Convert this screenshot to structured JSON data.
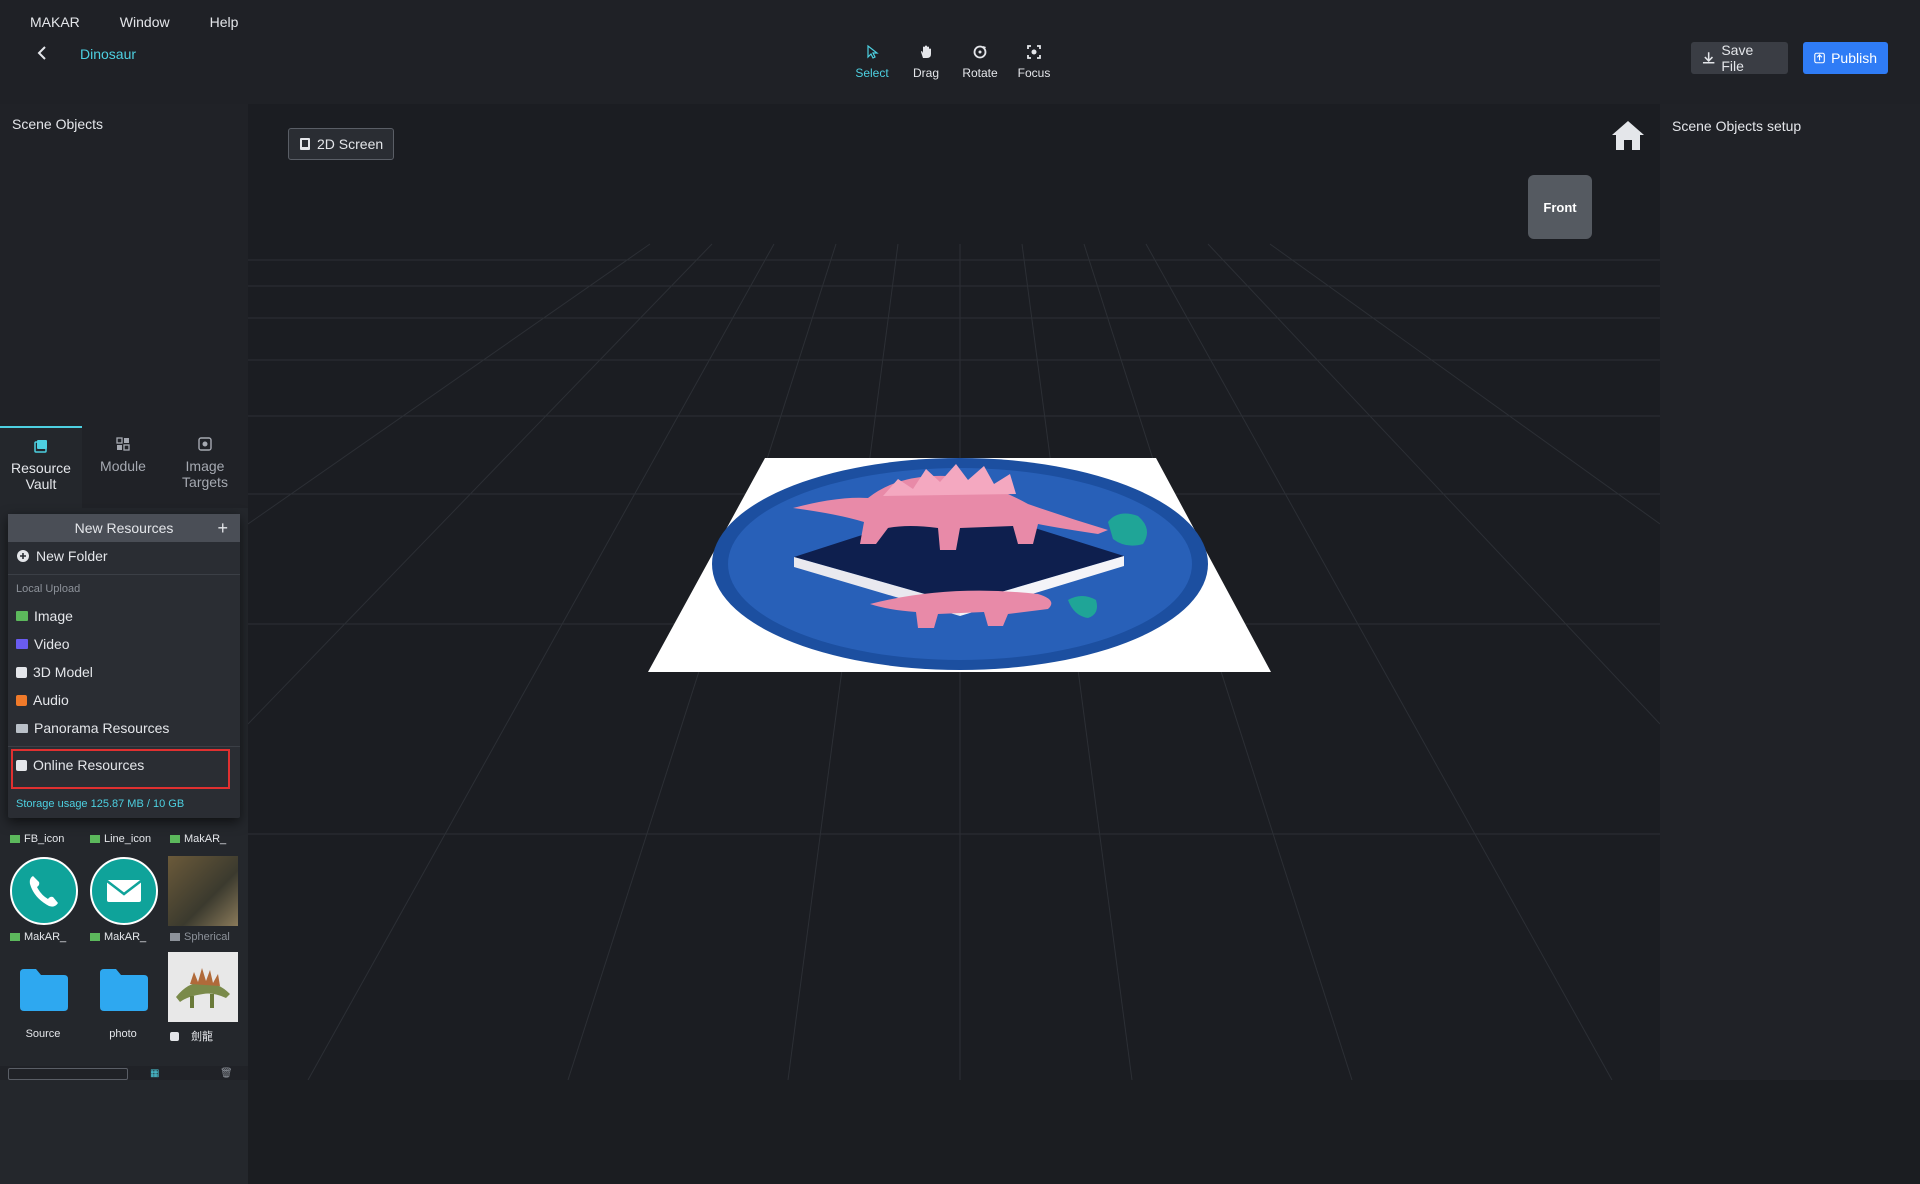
{
  "menu": [
    "MAKAR",
    "Window",
    "Help"
  ],
  "project_name": "Dinosaur",
  "tools": [
    {
      "label": "Select",
      "icon": "cursor-icon",
      "active": true
    },
    {
      "label": "Drag",
      "icon": "hand-icon",
      "active": false
    },
    {
      "label": "Rotate",
      "icon": "rotate-icon",
      "active": false
    },
    {
      "label": "Focus",
      "icon": "focus-icon",
      "active": false
    }
  ],
  "buttons": {
    "save": "Save File",
    "publish": "Publish"
  },
  "left_panel": {
    "title": "Scene Objects",
    "tabs": [
      {
        "label": "Resource Vault",
        "active": true
      },
      {
        "label": "Module",
        "active": false
      },
      {
        "label": "Image Targets",
        "active": false
      }
    ]
  },
  "dropdown": {
    "header": "New Resources",
    "new_folder": "New Folder",
    "section_local": "Local Upload",
    "items": [
      "Image",
      "Video",
      "3D Model",
      "Audio",
      "Panorama Resources"
    ],
    "online": "Online Resources",
    "storage": "Storage usage  125.87 MB / 10 GB"
  },
  "resources": {
    "row1": [
      "FB_icon",
      "Line_icon",
      "MakAR_"
    ],
    "row2": [
      "MakAR_",
      "MakAR_",
      "Spherical"
    ],
    "row3": [
      "Source",
      "photo",
      "劍龍"
    ]
  },
  "viewport": {
    "screen_button": "2D Screen",
    "cube_face": "Front"
  },
  "right_panel": {
    "title": "Scene Objects setup"
  },
  "colors": {
    "accent": "#4dd0e1",
    "publish": "#2f7cf6",
    "highlight": "#e03030"
  }
}
